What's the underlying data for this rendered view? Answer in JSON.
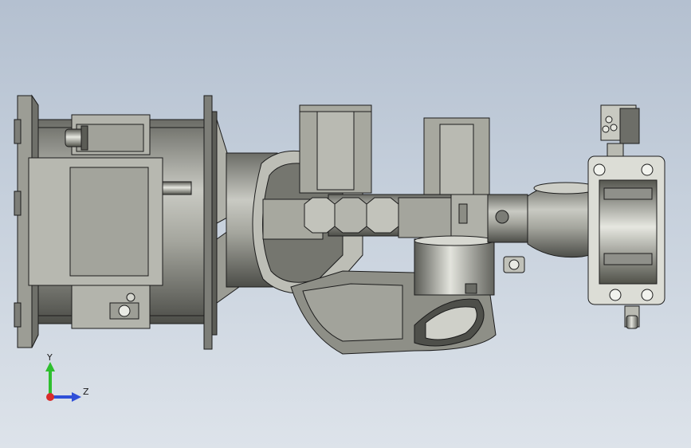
{
  "viewport": {
    "background_top": "#b4c0d0",
    "background_bottom": "#dde3ea",
    "model_fill": "#a9aaa2",
    "model_dark": "#5e605a",
    "model_light": "#d9dad3",
    "edge_color": "#1c1c1c"
  },
  "triad": {
    "y_label": "Y",
    "z_label": "Z",
    "y_color": "#2fbf2f",
    "z_color": "#2f4fd8",
    "x_color": "#d92b2b"
  }
}
